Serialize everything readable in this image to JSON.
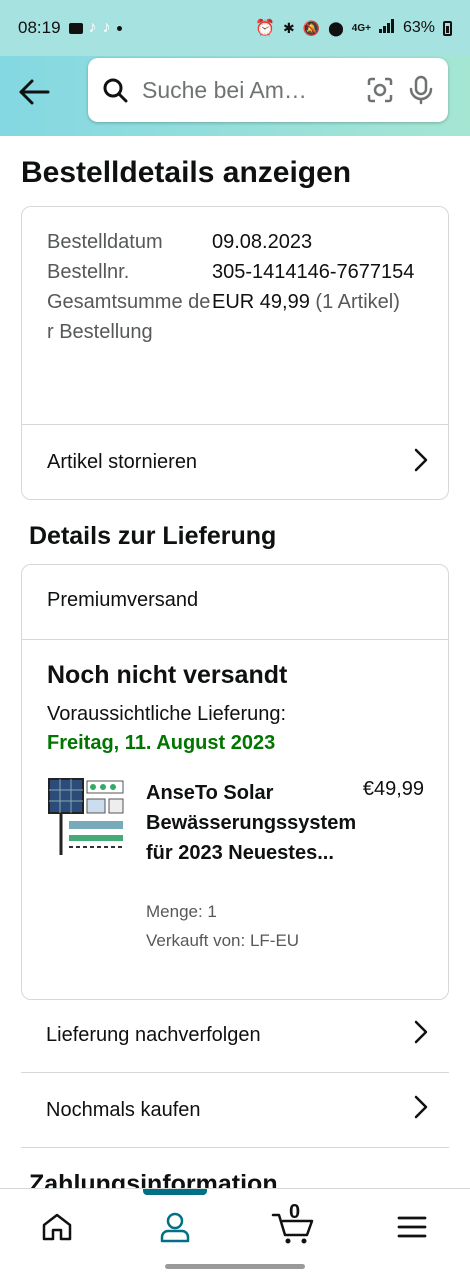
{
  "status_bar": {
    "time": "08:19",
    "network": "4G+",
    "battery": "63%"
  },
  "search": {
    "placeholder": "Suche bei Am…"
  },
  "page": {
    "title": "Bestelldetails anzeigen"
  },
  "order_info": {
    "rows": [
      {
        "label": "Bestelldatum",
        "value": "09.08.2023"
      },
      {
        "label": "Bestellnr.",
        "value": "305-1414146-7677154"
      },
      {
        "label": "Gesamtsumme der Bestellung",
        "value": "EUR 49,99",
        "extra": "(1 Artikel)"
      }
    ],
    "cancel_label": "Artikel stornieren"
  },
  "delivery": {
    "section_title": "Details zur Lieferung",
    "shipping_method": "Premiumversand",
    "status": "Noch nicht versandt",
    "eta_label": "Voraussichtliche Lieferung:",
    "eta_date": "Freitag, 11. August 2023",
    "status_color": "#007600",
    "item": {
      "title": "AnseTo Solar Bewässerungssystem für 2023 Neuestes...",
      "price": "€49,99",
      "quantity": "Menge: 1",
      "seller": "Verkauft von: LF-EU"
    }
  },
  "actions": {
    "track": "Lieferung nachverfolgen",
    "buy_again": "Nochmals kaufen"
  },
  "payment": {
    "section_title": "Zahlungsinformation"
  },
  "bottom_nav": {
    "cart_count": "0",
    "items": [
      "home-icon",
      "account-icon",
      "cart-icon",
      "menu-icon"
    ],
    "active": "account-icon",
    "accent": "#007185"
  }
}
